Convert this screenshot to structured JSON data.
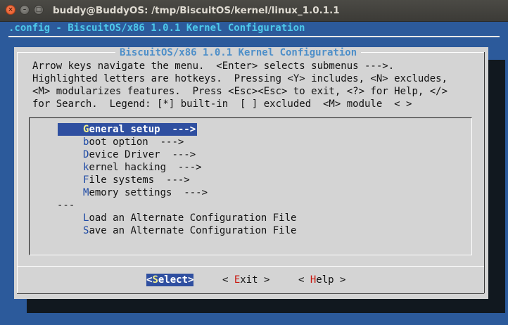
{
  "window": {
    "title": "buddy@BuddyOS: /tmp/BiscuitOS/kernel/linux_1.0.1.1",
    "buttons": {
      "close": "×",
      "minimize": "–",
      "maximize": "□"
    }
  },
  "terminal": {
    "config_line": ".config - BiscuitOS/x86 1.0.1 Kernel Configuration"
  },
  "dialog": {
    "title": "BiscuitOS/x86 1.0.1 Kernel Configuration",
    "help_lines": [
      "Arrow keys navigate the menu.  <Enter> selects submenus --->.",
      "Highlighted letters are hotkeys.  Pressing <Y> includes, <N> excludes,",
      "<M> modularizes features.  Press <Esc><Esc> to exit, <?> for Help, </>",
      "for Search.  Legend: [*] built-in  [ ] excluded  <M> module  < >"
    ],
    "menu_items": [
      {
        "hotkey": "G",
        "rest": "eneral setup  --->"
      },
      {
        "hotkey": "b",
        "rest": "oot option  --->"
      },
      {
        "hotkey": "D",
        "rest": "evice Driver  --->"
      },
      {
        "hotkey": "k",
        "rest": "ernel hacking  --->"
      },
      {
        "hotkey": "F",
        "rest": "ile systems  --->"
      },
      {
        "hotkey": "M",
        "rest": "emory settings  --->"
      }
    ],
    "separator": "---",
    "file_items": [
      {
        "hotkey": "L",
        "rest": "oad an Alternate Configuration File"
      },
      {
        "hotkey": "S",
        "rest": "ave an Alternate Configuration File"
      }
    ],
    "buttons": {
      "select": {
        "left": "<",
        "hotkey": "S",
        "rest": "elect",
        "right": ">"
      },
      "exit": {
        "left": "< ",
        "hotkey": "E",
        "rest": "xit",
        "right": " >"
      },
      "help": {
        "left": "< ",
        "hotkey": "H",
        "rest": "elp",
        "right": " >"
      }
    }
  },
  "colors": {
    "terminal_bg": "#2c5a9b",
    "dialog_bg": "#d4d4d4",
    "selection_bg": "#2f4fa0",
    "hotkey_selected": "#f3f08c",
    "title_accent": "#4e8fc9",
    "config_line": "#4ec9e9"
  }
}
